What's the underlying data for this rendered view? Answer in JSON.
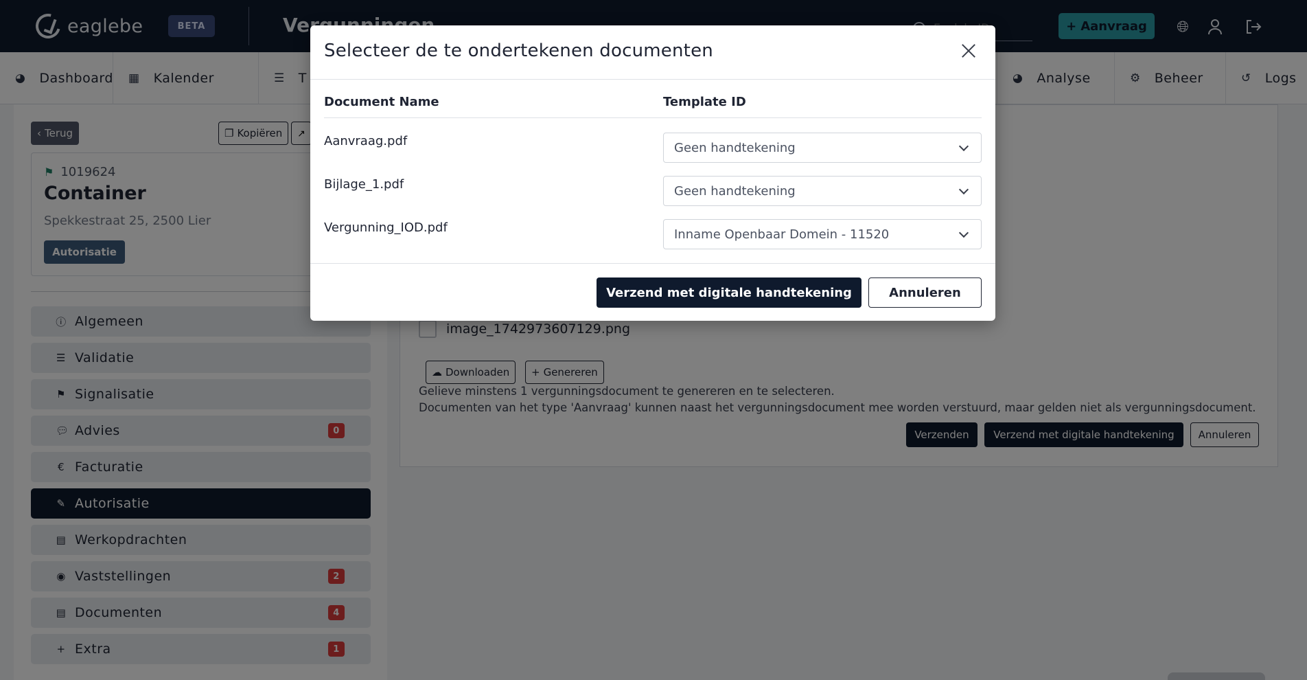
{
  "topbar": {
    "logo_text": "eaglebe",
    "beta_label": "BETA",
    "page_title": "Vergunningen",
    "search_placeholder": "EaglebeID",
    "aanvraag_label": "Aanvraag"
  },
  "subnav": {
    "items": [
      {
        "label": "Dashboard",
        "icon": "palette-icon"
      },
      {
        "label": "Kalender",
        "icon": "calendar-icon"
      },
      {
        "label": "T",
        "icon": "list-check-icon"
      },
      {
        "label": "Analyse",
        "icon": "palette-icon"
      },
      {
        "label": "Beheer",
        "icon": "gears-icon"
      },
      {
        "label": "Logs",
        "icon": "history-icon"
      }
    ]
  },
  "left": {
    "back_label": "Terug",
    "copy_label": "Kopiëren",
    "record_id": "1019624",
    "record_title": "Container",
    "record_address": "Spekkestraat 25, 2500 Lier",
    "status_badge": "Autorisatie",
    "menu": [
      {
        "label": "Algemeen",
        "count": ""
      },
      {
        "label": "Validatie",
        "count": ""
      },
      {
        "label": "Signalisatie",
        "count": ""
      },
      {
        "label": "Advies",
        "count": "0"
      },
      {
        "label": "Facturatie",
        "count": ""
      },
      {
        "label": "Autorisatie",
        "count": ""
      },
      {
        "label": "Werkopdrachten",
        "count": ""
      },
      {
        "label": "Vaststellingen",
        "count": "2"
      },
      {
        "label": "Documenten",
        "count": "4"
      },
      {
        "label": "Extra",
        "count": "1"
      }
    ]
  },
  "right": {
    "file_name": "image_1742973607129.png",
    "download_label": "Downloaden",
    "generate_label": "Genereren",
    "help_line1": "Gelieve minstens 1 vergunningsdocument te genereren en te selecteren.",
    "help_line2": "Documenten van het type 'Aanvraag' kunnen naast het vergunningsdocument mee worden verstuurd, maar gelden niet als vergunningsdocument.",
    "send_label": "Verzenden",
    "send_signed_label": "Verzend met digitale handtekening",
    "cancel_label": "Annuleren"
  },
  "modal": {
    "title": "Selecteer de te ondertekenen documenten",
    "col_document": "Document Name",
    "col_template": "Template ID",
    "rows": [
      {
        "document": "Aanvraag.pdf",
        "template": "Geen handtekening"
      },
      {
        "document": "Bijlage_1.pdf",
        "template": "Geen handtekening"
      },
      {
        "document": "Vergunning_IOD.pdf",
        "template": "Inname Openbaar Domein - 11520"
      }
    ],
    "confirm_label": "Verzend met digitale handtekening",
    "cancel_label": "Annuleren"
  },
  "colors": {
    "navy": "#0f1a2d",
    "teal": "#2a9aa5",
    "badge_red": "#d93b3b",
    "status_blue": "#3d5a7a"
  }
}
